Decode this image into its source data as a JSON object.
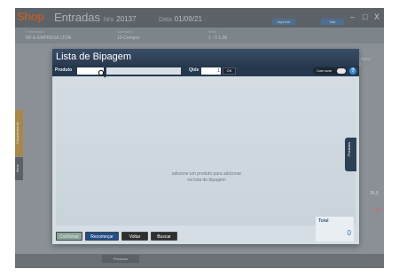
{
  "background_app": {
    "logo": "Shop",
    "title": "Entradas",
    "nro_label": "Nro",
    "nro_value": "20137",
    "data_label": "Data",
    "data_value": "01/09/21",
    "btn_a": "Imprimir",
    "btn_b": "Sair",
    "win_min": "–",
    "win_max": "□",
    "win_close": "X",
    "fornecedor_label": "Fornecedor",
    "fornecedor_value": "NF-E EMPRESA LTDA",
    "operacao_label": "Operação",
    "operacao_value": "10-Compra",
    "serie_label": "Série",
    "serie_value": "1 - 5 1.06",
    "side_tab_1": "Complemento",
    "side_tab_2": "Itens",
    "right_label": "Compra",
    "right_value": "10",
    "right_v1": "36,5",
    "right_v2": "0,00",
    "bottom_tab": "Produtos"
  },
  "modal": {
    "title": "Lista de Bipagem",
    "product_label": "Produto",
    "product_value": "",
    "qty_label": "Qtde",
    "qty_value": "1",
    "ok_label": "OK",
    "sound_label": "Com som",
    "help_label": "?",
    "empty_line1": "adicione um produto para adicionar",
    "empty_line2": "na lista de bipagem",
    "side_tab": "Produtos",
    "total_label": "Total",
    "total_value": "0",
    "buttons": {
      "confirm": "Confirmar",
      "restart": "Recomeçar",
      "back": "Voltar",
      "search": "Buscar"
    }
  }
}
